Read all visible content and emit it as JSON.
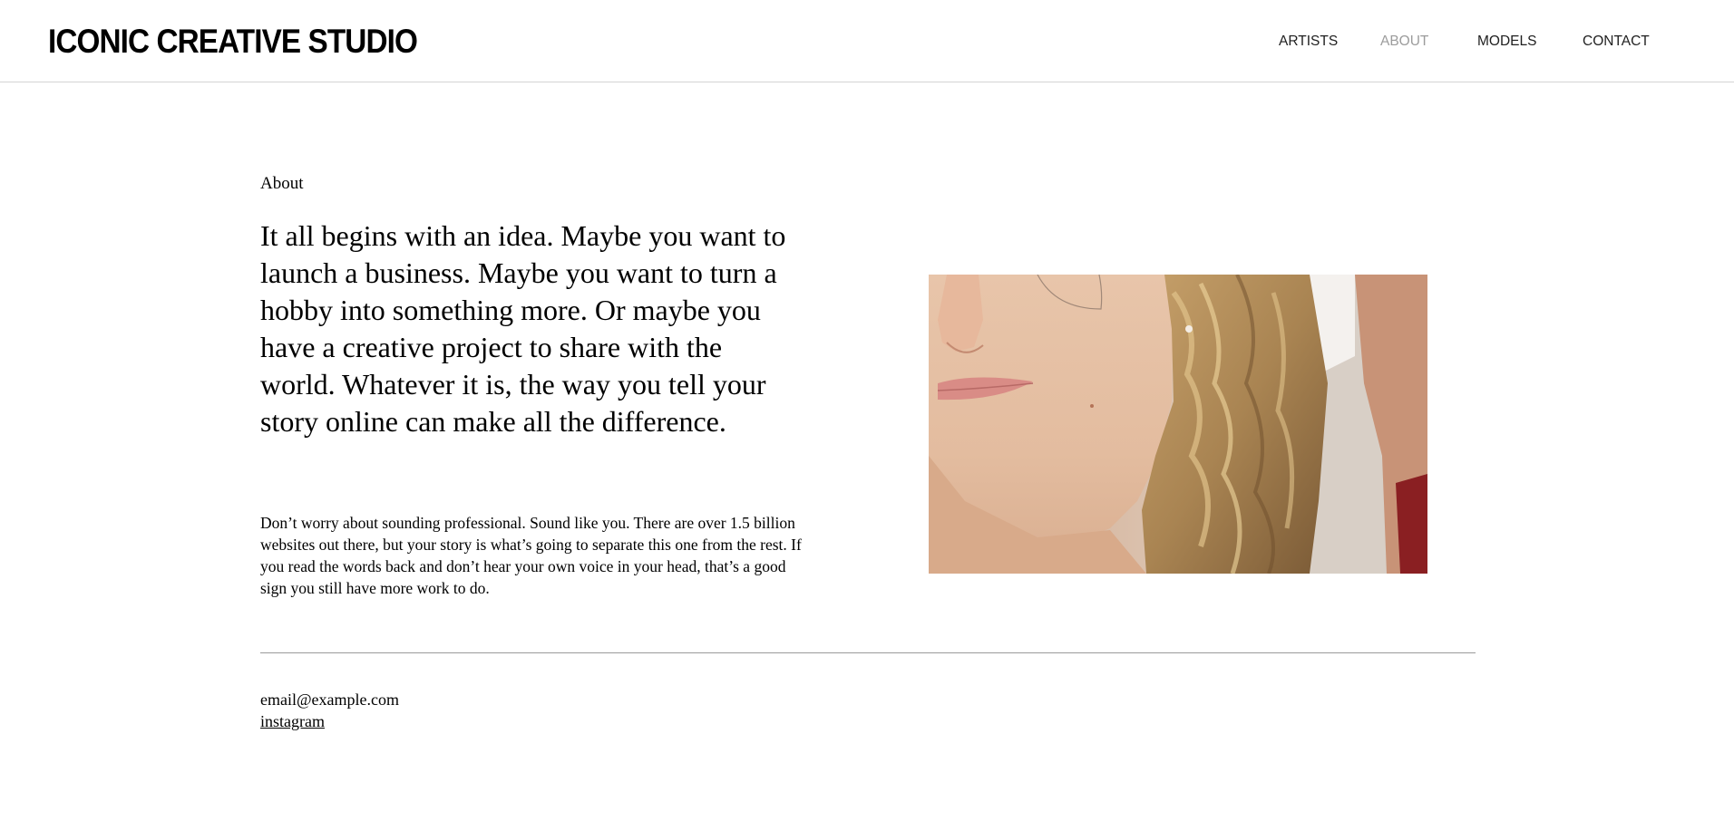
{
  "header": {
    "brand": "ICONIC CREATIVE STUDIO",
    "nav": [
      {
        "label": "ARTISTS",
        "active": false
      },
      {
        "label": "ABOUT",
        "active": true
      },
      {
        "label": "MODELS",
        "active": false
      },
      {
        "label": "CONTACT",
        "active": false
      }
    ]
  },
  "main": {
    "eyebrow": "About",
    "headline": "It all begins with an idea. Maybe you want to launch a business. Maybe you want to turn a hobby into something more. Or maybe you have a creative project to share with the world. Whatever it is, the way you tell your story online can make all the difference.",
    "body": "Don’t worry about sounding professional. Sound like you. There are over 1.5 billion websites out there, but your story is what’s going to separate this one from the rest. If you read the words back and don’t hear your own voice in your head, that’s a good sign you still have more work to do."
  },
  "footer": {
    "email": "email@example.com",
    "social_link": "instagram"
  },
  "colors": {
    "text": "#000000",
    "nav_active": "#9c9c9c",
    "divider": "#9a9a9a",
    "header_border": "#d4d4d4"
  }
}
